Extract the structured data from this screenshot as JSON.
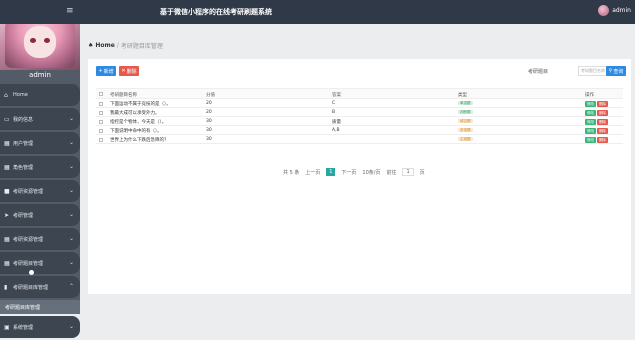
{
  "header": {
    "title": "基于微信小程序的在线考研刷题系统",
    "menu_icon": "≡",
    "user_name": "admin"
  },
  "sidebar": {
    "admin_name": "admin",
    "items": [
      {
        "label": "Home",
        "icon": "home-icon",
        "glyph": "⌂"
      },
      {
        "label": "我的信息",
        "icon": "profile-icon",
        "glyph": "▭"
      },
      {
        "label": "用户管理",
        "icon": "grid-icon",
        "glyph": "▦"
      },
      {
        "label": "角色管理",
        "icon": "grid-icon",
        "glyph": "▦"
      },
      {
        "label": "考研资源管理",
        "icon": "list-icon",
        "glyph": "■"
      },
      {
        "label": "考研管理",
        "icon": "send-icon",
        "glyph": "➤"
      },
      {
        "label": "考研资源管理",
        "icon": "grid-icon",
        "glyph": "▦"
      },
      {
        "label": "考研题目管理",
        "icon": "grid-icon",
        "glyph": "▦"
      },
      {
        "label": "考研题目库管理",
        "icon": "bar-chart-icon",
        "glyph": "▮"
      }
    ],
    "sub_item": "考研题目库管理",
    "last_item": {
      "label": "系统管理",
      "glyph": "▣"
    }
  },
  "breadcrumb": {
    "home": "Home",
    "current": "考研题目库管理"
  },
  "toolbar": {
    "add_label": "新增",
    "delete_label": "删除",
    "search_label": "考研题目",
    "search_placeholder": "考研题目名称",
    "search_button": "查询"
  },
  "table": {
    "headers": [
      "考研题目名称",
      "分值",
      "答案",
      "类型",
      "操作"
    ],
    "rows": [
      {
        "name": "下面运动不属于竞技的是（）。",
        "score": "20",
        "answer": "C",
        "type": "单选题",
        "type_color": "green"
      },
      {
        "name": "我最大成可以承受外力。",
        "score": "20",
        "answer": "B",
        "type": "判断题",
        "type_color": "green"
      },
      {
        "name": "指控是个物体，今天是（）。",
        "score": "30",
        "answer": "质量",
        "type": "填空题",
        "type_color": "orange"
      },
      {
        "name": "下面说明中命中的有（）。",
        "score": "30",
        "answer": "A,B",
        "type": "多选题",
        "type_color": "orange"
      },
      {
        "name": "世界上为什么下跌后急降的？",
        "score": "30",
        "answer": "",
        "type": "主观题",
        "type_color": "orange"
      }
    ],
    "edit_label": "修改",
    "delete_label": "删除"
  },
  "pager": {
    "total": "共 5 条",
    "prev": "上一页",
    "current": "1",
    "next": "下一页",
    "size": "10条/页",
    "goto": "前往",
    "goto_page": "1",
    "page_unit": "页"
  }
}
